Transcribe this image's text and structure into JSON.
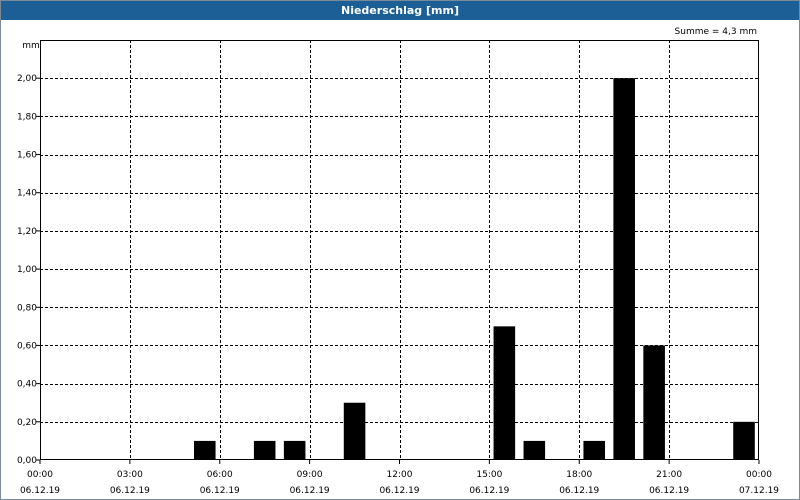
{
  "window": {
    "title": "Niederschlag [mm]"
  },
  "chart_data": {
    "type": "bar",
    "title": "Niederschlag [mm]",
    "ylabel": "mm",
    "annotation": "Summe = 4,3 mm",
    "ylim": [
      0,
      2.2
    ],
    "yticks": [
      0,
      0.2,
      0.4,
      0.6,
      0.8,
      1.0,
      1.2,
      1.4,
      1.6,
      1.8,
      2.0
    ],
    "ytick_labels": [
      "0,00",
      "0,20",
      "0,40",
      "0,60",
      "0,80",
      "1,00",
      "1,20",
      "1,40",
      "1,60",
      "1,80",
      "2,00"
    ],
    "xlim_hours": [
      0,
      24
    ],
    "xticks": [
      {
        "hour": 0,
        "time": "00:00",
        "date": "06.12.19"
      },
      {
        "hour": 3,
        "time": "03:00",
        "date": "06.12.19"
      },
      {
        "hour": 6,
        "time": "06:00",
        "date": "06.12.19"
      },
      {
        "hour": 9,
        "time": "09:00",
        "date": "06.12.19"
      },
      {
        "hour": 12,
        "time": "12:00",
        "date": "06.12.19"
      },
      {
        "hour": 15,
        "time": "15:00",
        "date": "06.12.19"
      },
      {
        "hour": 18,
        "time": "18:00",
        "date": "06.12.19"
      },
      {
        "hour": 21,
        "time": "21:00",
        "date": "06.12.19"
      },
      {
        "hour": 24,
        "time": "00:00",
        "date": "07.12.19"
      }
    ],
    "grid": true,
    "bar_color": "#000000",
    "bars": [
      {
        "hour": 5.5,
        "value": 0.1
      },
      {
        "hour": 7.5,
        "value": 0.1
      },
      {
        "hour": 8.5,
        "value": 0.1
      },
      {
        "hour": 10.5,
        "value": 0.3
      },
      {
        "hour": 15.5,
        "value": 0.7
      },
      {
        "hour": 16.5,
        "value": 0.1
      },
      {
        "hour": 18.5,
        "value": 0.1
      },
      {
        "hour": 19.5,
        "value": 2.0
      },
      {
        "hour": 20.5,
        "value": 0.6
      },
      {
        "hour": 23.5,
        "value": 0.2
      }
    ]
  }
}
